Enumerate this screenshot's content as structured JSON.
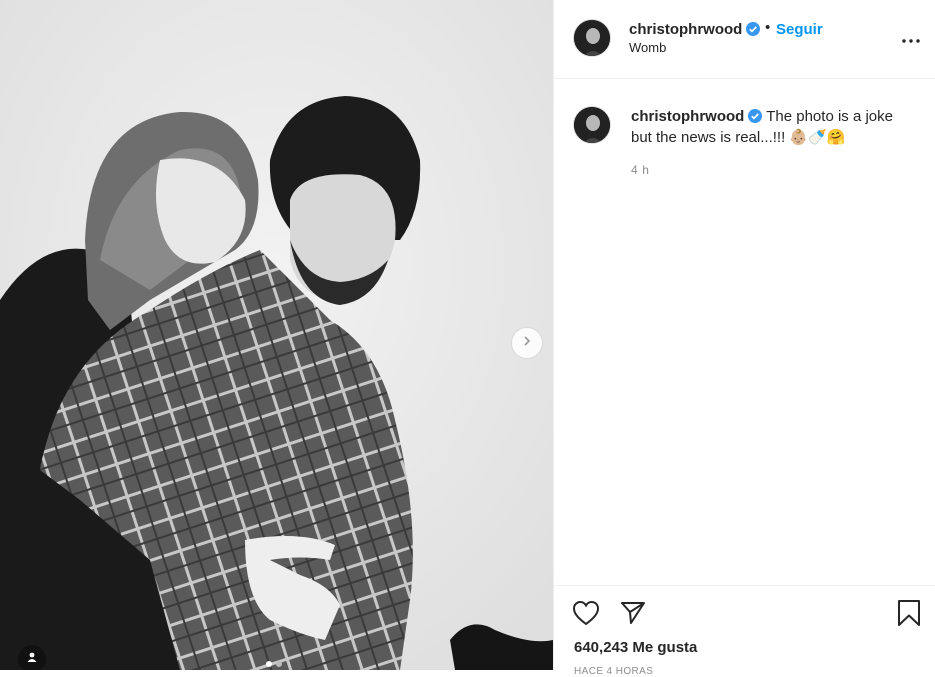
{
  "post": {
    "username": "christophrwood",
    "verified": true,
    "separator": "•",
    "follow_label": "Seguir",
    "location": "Womb",
    "more_icon": "more-horizontal-icon"
  },
  "media": {
    "description_icon": "photo",
    "next_icon": "chevron-right-icon",
    "carousel_count": 2,
    "carousel_active": 0,
    "tag_icon": "user-tag-icon"
  },
  "caption": {
    "username": "christophrwood",
    "text": "The photo is a joke but the news is real...!!! 👶🏼🍼🤗",
    "time": "4 h"
  },
  "actions": {
    "like_icon": "heart-icon",
    "share_icon": "share-icon",
    "save_icon": "bookmark-icon",
    "likes_text": "640,243 Me gusta",
    "posted_ago": "HACE 4 HORAS"
  },
  "colors": {
    "accent": "#0095f6",
    "verified": "#3897f0",
    "text": "#262626",
    "muted": "#8e8e8e",
    "divider": "#efefef"
  }
}
